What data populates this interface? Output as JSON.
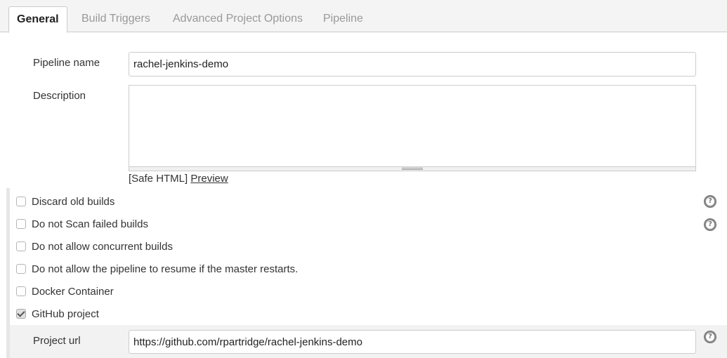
{
  "tabs": [
    {
      "label": "General",
      "active": true
    },
    {
      "label": "Build Triggers",
      "active": false
    },
    {
      "label": "Advanced Project Options",
      "active": false
    },
    {
      "label": "Pipeline",
      "active": false
    }
  ],
  "form": {
    "pipeline_name_label": "Pipeline name",
    "pipeline_name_value": "rachel-jenkins-demo",
    "description_label": "Description",
    "description_value": "",
    "safe_html_text": "[Safe HTML]",
    "preview_link": "Preview"
  },
  "options": [
    {
      "label": "Discard old builds",
      "checked": false,
      "help": true
    },
    {
      "label": "Do not Scan failed builds",
      "checked": false,
      "help": true
    },
    {
      "label": "Do not allow concurrent builds",
      "checked": false,
      "help": false
    },
    {
      "label": "Do not allow the pipeline to resume if the master restarts.",
      "checked": false,
      "help": false
    },
    {
      "label": "Docker Container",
      "checked": false,
      "help": false
    },
    {
      "label": "GitHub project",
      "checked": true,
      "help": false
    }
  ],
  "github": {
    "project_url_label": "Project url",
    "project_url_value": "https://github.com/rpartridge/rachel-jenkins-demo"
  },
  "icons": {
    "help": "help-icon",
    "checkbox": "checkbox-icon"
  },
  "colors": {
    "tab_bar_bg": "#f4f4f4",
    "nested_section_bg": "#f2f2f2",
    "border": "#cccccc"
  }
}
